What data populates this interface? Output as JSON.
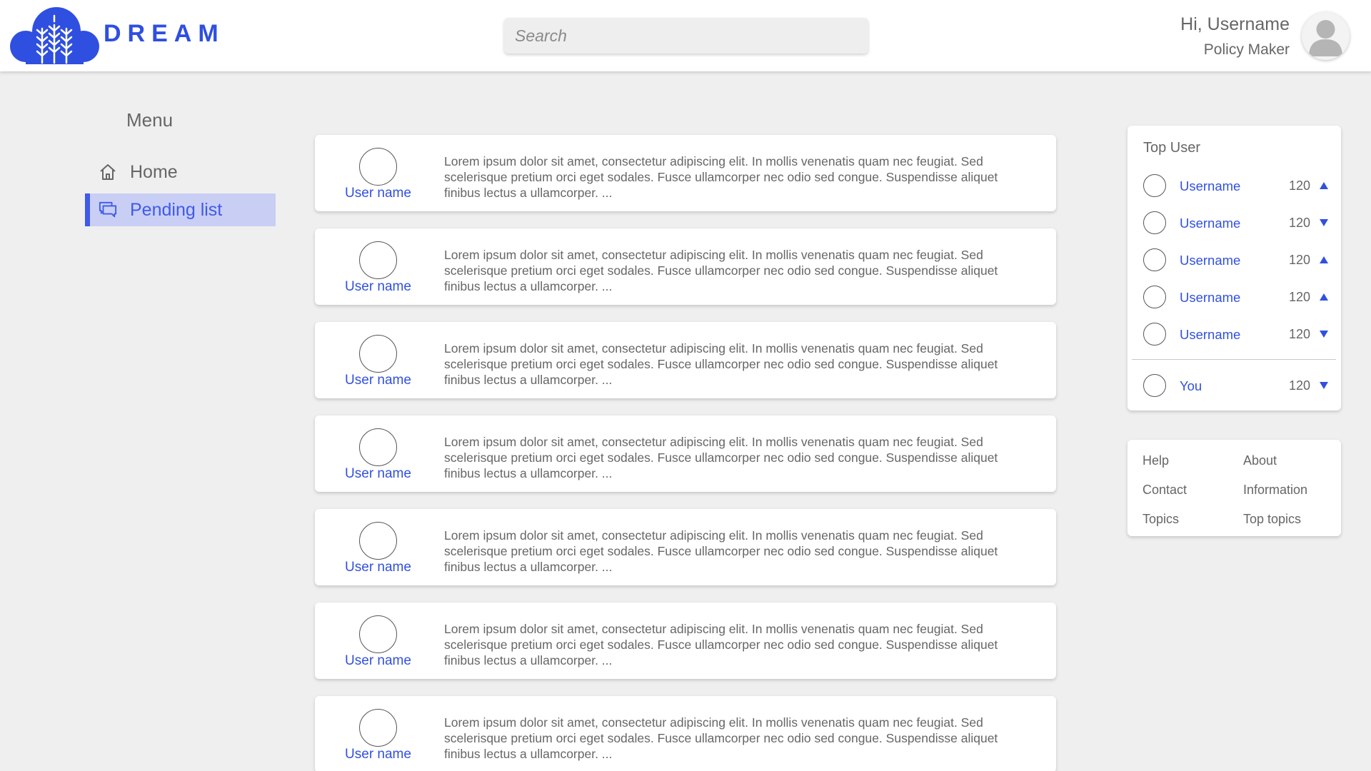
{
  "header": {
    "brand": "DREAM",
    "search_placeholder": "Search",
    "greeting": "Hi, Username",
    "role": "Policy Maker",
    "colors": {
      "accent": "#2f4fe0",
      "background": "#efefef"
    }
  },
  "menu": {
    "title": "Menu",
    "items": [
      {
        "label": "Home",
        "icon": "home-icon",
        "active": false
      },
      {
        "label": "Pending list",
        "icon": "chat-icon",
        "active": true
      }
    ]
  },
  "feed": {
    "posts": [
      {
        "user": "User name",
        "text": "Lorem ipsum dolor sit amet, consectetur adipiscing elit. In mollis venenatis quam nec feugiat. Sed scelerisque pretium orci eget sodales. Fusce ullamcorper nec odio sed congue. Suspendisse aliquet finibus lectus a ullamcorper. ..."
      },
      {
        "user": "User name",
        "text": "Lorem ipsum dolor sit amet, consectetur adipiscing elit. In mollis venenatis quam nec feugiat. Sed scelerisque pretium orci eget sodales. Fusce ullamcorper nec odio sed congue. Suspendisse aliquet finibus lectus a ullamcorper. ..."
      },
      {
        "user": "User name",
        "text": "Lorem ipsum dolor sit amet, consectetur adipiscing elit. In mollis venenatis quam nec feugiat. Sed scelerisque pretium orci eget sodales. Fusce ullamcorper nec odio sed congue. Suspendisse aliquet finibus lectus a ullamcorper. ..."
      },
      {
        "user": "User name",
        "text": "Lorem ipsum dolor sit amet, consectetur adipiscing elit. In mollis venenatis quam nec feugiat. Sed scelerisque pretium orci eget sodales. Fusce ullamcorper nec odio sed congue. Suspendisse aliquet finibus lectus a ullamcorper. ..."
      },
      {
        "user": "User name",
        "text": "Lorem ipsum dolor sit amet, consectetur adipiscing elit. In mollis venenatis quam nec feugiat. Sed scelerisque pretium orci eget sodales. Fusce ullamcorper nec odio sed congue. Suspendisse aliquet finibus lectus a ullamcorper. ..."
      },
      {
        "user": "User name",
        "text": "Lorem ipsum dolor sit amet, consectetur adipiscing elit. In mollis venenatis quam nec feugiat. Sed scelerisque pretium orci eget sodales. Fusce ullamcorper nec odio sed congue. Suspendisse aliquet finibus lectus a ullamcorper. ..."
      },
      {
        "user": "User name",
        "text": "Lorem ipsum dolor sit amet, consectetur adipiscing elit. In mollis venenatis quam nec feugiat. Sed scelerisque pretium orci eget sodales. Fusce ullamcorper nec odio sed congue. Suspendisse aliquet finibus lectus a ullamcorper. ..."
      }
    ]
  },
  "top_users": {
    "title": "Top User",
    "users": [
      {
        "name": "Username",
        "score": "120",
        "trend": "up"
      },
      {
        "name": "Username",
        "score": "120",
        "trend": "down"
      },
      {
        "name": "Username",
        "score": "120",
        "trend": "up"
      },
      {
        "name": "Username",
        "score": "120",
        "trend": "up"
      },
      {
        "name": "Username",
        "score": "120",
        "trend": "down"
      }
    ],
    "you": {
      "name": "You",
      "score": "120",
      "trend": "down"
    }
  },
  "footer_links": {
    "help": "Help",
    "about": "About",
    "contact": "Contact",
    "information": "Information",
    "topics": "Topics",
    "top_topics": "Top topics"
  }
}
